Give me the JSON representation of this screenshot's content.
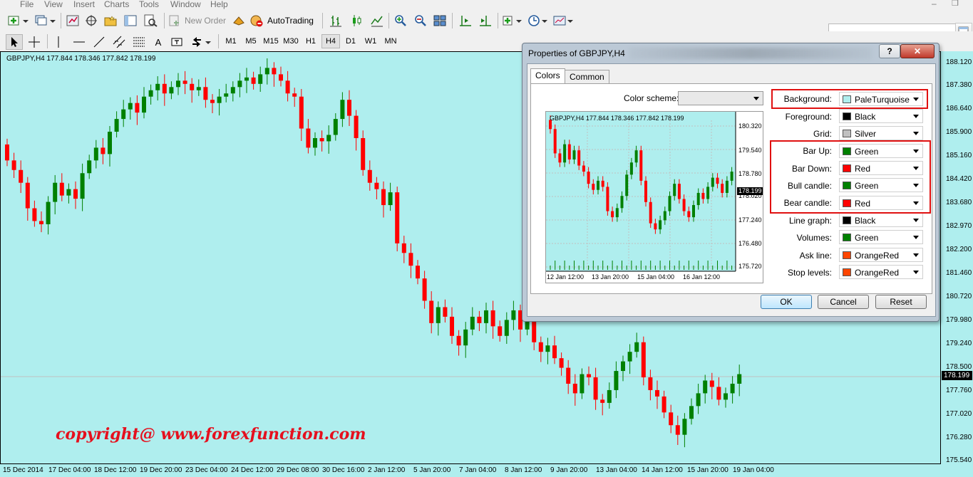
{
  "menu": [
    "File",
    "View",
    "Insert",
    "Charts",
    "Tools",
    "Window",
    "Help"
  ],
  "toolbar": {
    "new_order": "New Order",
    "autotrading": "AutoTrading"
  },
  "timeframes": [
    "M1",
    "M5",
    "M15",
    "M30",
    "H1",
    "H4",
    "D1",
    "W1",
    "MN"
  ],
  "active_timeframe": "H4",
  "chart": {
    "symbol_info": "GBPJPY,H4  177.844 178.346 177.842 178.199",
    "current_price": "178.199",
    "background": "#afeeee",
    "price_labels": [
      "188.120",
      "187.380",
      "186.640",
      "185.900",
      "185.160",
      "184.420",
      "183.680",
      "182.970",
      "182.200",
      "181.460",
      "180.720",
      "179.980",
      "179.240",
      "178.500",
      "177.760",
      "177.020",
      "176.280",
      "175.540"
    ],
    "time_labels": [
      "15 Dec 2014",
      "17 Dec 04:00",
      "18 Dec 12:00",
      "19 Dec 20:00",
      "23 Dec 04:00",
      "24 Dec 12:00",
      "29 Dec 08:00",
      "30 Dec 16:00",
      "2 Jan 12:00",
      "5 Jan 20:00",
      "7 Jan 04:00",
      "8 Jan 12:00",
      "9 Jan 20:00",
      "13 Jan 04:00",
      "14 Jan 12:00",
      "15 Jan 20:00",
      "19 Jan 04:00"
    ],
    "watermark": "copyright@ www.forexfunction.com"
  },
  "chart_data": {
    "type": "candlestick",
    "closes": [
      184.9,
      184.6,
      184.2,
      183.4,
      183.0,
      182.9,
      183.6,
      184.2,
      183.8,
      184.0,
      183.7,
      184.5,
      184.9,
      185.3,
      185.1,
      185.8,
      186.2,
      186.5,
      186.7,
      186.4,
      186.9,
      187.1,
      187.3,
      187.0,
      187.2,
      187.4,
      187.3,
      187.1,
      187.2,
      186.8,
      186.7,
      186.9,
      187.0,
      187.2,
      187.4,
      187.5,
      187.3,
      187.6,
      187.8,
      187.6,
      187.4,
      187.0,
      186.9,
      185.9,
      185.3,
      185.6,
      185.5,
      185.7,
      186.2,
      186.8,
      186.3,
      185.6,
      184.6,
      184.2,
      184.0,
      183.5,
      183.9,
      182.3,
      182.0,
      181.6,
      181.2,
      180.5,
      179.8,
      180.3,
      180.0,
      179.4,
      179.1,
      179.6,
      180.0,
      179.8,
      180.2,
      179.7,
      179.4,
      179.9,
      180.2,
      179.6,
      179.9,
      179.2,
      178.9,
      179.1,
      178.7,
      178.4,
      177.9,
      177.6,
      178.2,
      178.1,
      177.4,
      177.3,
      177.7,
      178.3,
      178.6,
      178.9,
      179.2,
      178.1,
      177.7,
      177.5,
      177.0,
      176.6,
      176.3,
      176.8,
      177.2,
      177.6,
      178.0,
      177.8,
      177.4,
      177.6,
      177.9,
      178.2
    ],
    "series_colors": {
      "bull": "#008000",
      "bear": "#ff0000"
    }
  },
  "dialog": {
    "title": "Properties of GBPJPY,H4",
    "help": "?",
    "close": "✕",
    "tabs": [
      {
        "label": "Colors",
        "active": true
      },
      {
        "label": "Common",
        "active": false
      }
    ],
    "color_scheme_label": "Color scheme:",
    "color_scheme_value": "",
    "rows": [
      {
        "label": "Background:",
        "value": "PaleTurquoise",
        "color": "#afeeee"
      },
      {
        "label": "Foreground:",
        "value": "Black",
        "color": "#000000"
      },
      {
        "label": "Grid:",
        "value": "Silver",
        "color": "#c0c0c0"
      },
      {
        "label": "Bar Up:",
        "value": "Green",
        "color": "#008000"
      },
      {
        "label": "Bar Down:",
        "value": "Red",
        "color": "#ff0000"
      },
      {
        "label": "Bull candle:",
        "value": "Green",
        "color": "#008000"
      },
      {
        "label": "Bear candle:",
        "value": "Red",
        "color": "#ff0000"
      },
      {
        "label": "Line graph:",
        "value": "Black",
        "color": "#000000"
      },
      {
        "label": "Volumes:",
        "value": "Green",
        "color": "#008000"
      },
      {
        "label": "Ask line:",
        "value": "OrangeRed",
        "color": "#ff4500"
      },
      {
        "label": "Stop levels:",
        "value": "OrangeRed",
        "color": "#ff4500"
      }
    ],
    "preview": {
      "symbol_info": "GBPJPY,H4  177.844 178.346 177.842 178.199",
      "price_labels": [
        "180.320",
        "179.540",
        "178.780",
        "178.020",
        "177.240",
        "176.480",
        "175.720"
      ],
      "current_price": "178.199",
      "time_labels": [
        "12 Jan 12:00",
        "13 Jan 20:00",
        "15 Jan 04:00",
        "16 Jan 12:00"
      ]
    },
    "buttons": {
      "ok": "OK",
      "cancel": "Cancel",
      "reset": "Reset"
    }
  }
}
